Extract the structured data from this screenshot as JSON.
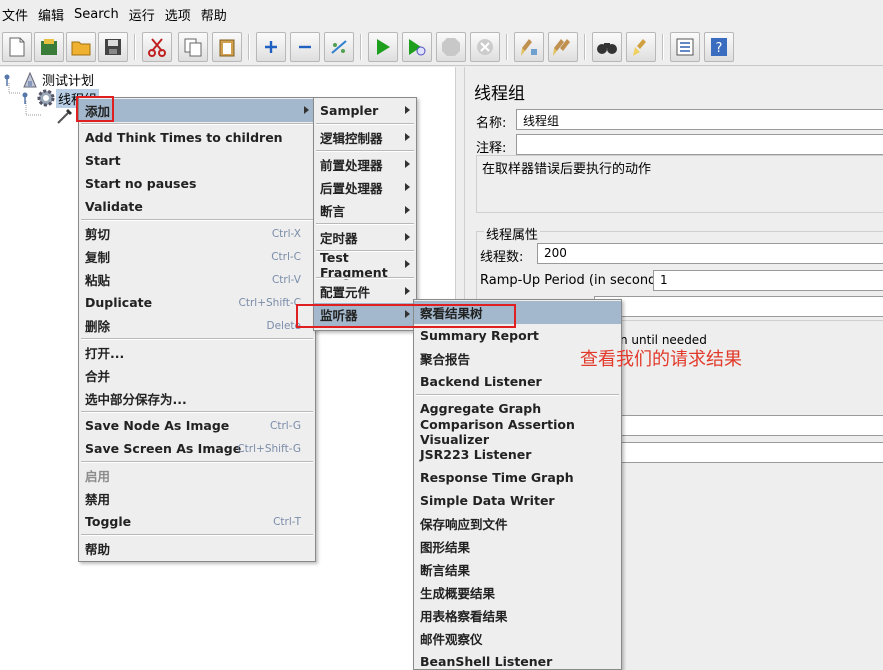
{
  "menubar": {
    "items": [
      "文件",
      "编辑",
      "Search",
      "运行",
      "选项",
      "帮助"
    ]
  },
  "toolbar": {
    "buttons": [
      "new-icon",
      "templates-icon",
      "open-icon",
      "save-icon",
      "cut-icon",
      "copy-icon",
      "paste-icon",
      "expand-icon",
      "collapse-icon",
      "toggle-icon",
      "start-icon",
      "start-no-pauses-icon",
      "stop-icon",
      "shutdown-icon",
      "clear-icon",
      "clear-all-icon",
      "search-icon",
      "reset-search-icon",
      "function-helper-icon",
      "help-icon"
    ]
  },
  "tree": {
    "root": "测试计划",
    "thread_group": "线程组"
  },
  "right_panel": {
    "title": "线程组",
    "name_label": "名称:",
    "name_value": "线程组",
    "comment_label": "注释:",
    "error_action_title": "在取样器错误后要执行的动作",
    "thread_props_title": "线程属性",
    "threads_label": "线程数:",
    "threads_value": "200",
    "rampup_label": "Ramp-Up Period (in seconds):",
    "rampup_value": "1",
    "partial_text": "n until needed"
  },
  "context_menu": {
    "add": "添加",
    "add_think_times": "Add Think Times to children",
    "start": "Start",
    "start_no_pauses": "Start no pauses",
    "validate": "Validate",
    "cut": "剪切",
    "cut_sc": "Ctrl-X",
    "copy": "复制",
    "copy_sc": "Ctrl-C",
    "paste": "粘贴",
    "paste_sc": "Ctrl-V",
    "duplicate": "Duplicate",
    "duplicate_sc": "Ctrl+Shift-C",
    "delete": "删除",
    "delete_sc": "Delete",
    "open": "打开...",
    "merge": "合并",
    "save_selection": "选中部分保存为...",
    "save_node_image": "Save Node As Image",
    "save_node_image_sc": "Ctrl-G",
    "save_screen_image": "Save Screen As Image",
    "save_screen_image_sc": "Ctrl+Shift-G",
    "enable": "启用",
    "disable": "禁用",
    "toggle": "Toggle",
    "toggle_sc": "Ctrl-T",
    "help": "帮助"
  },
  "add_submenu": {
    "sampler": "Sampler",
    "logic_controller": "逻辑控制器",
    "pre_processor": "前置处理器",
    "post_processor": "后置处理器",
    "assertion": "断言",
    "timer": "定时器",
    "test_fragment": "Test Fragment",
    "config_element": "配置元件",
    "listener": "监听器"
  },
  "listener_submenu": {
    "items_a": [
      "察看结果树",
      "Summary Report",
      "聚合报告",
      "Backend Listener"
    ],
    "items_b": [
      "Aggregate Graph",
      "Comparison Assertion Visualizer",
      "JSR223 Listener",
      "Response Time Graph",
      "Simple Data Writer",
      "保存响应到文件",
      "图形结果",
      "断言结果",
      "生成概要结果",
      "用表格察看结果",
      "邮件观察仪",
      "BeanShell Listener"
    ]
  },
  "annotation": "查看我们的请求结果",
  "colors": {
    "highlight": "#a3b8cc",
    "annotation_red": "#e23a2a",
    "start_green": "#1ea01e"
  }
}
